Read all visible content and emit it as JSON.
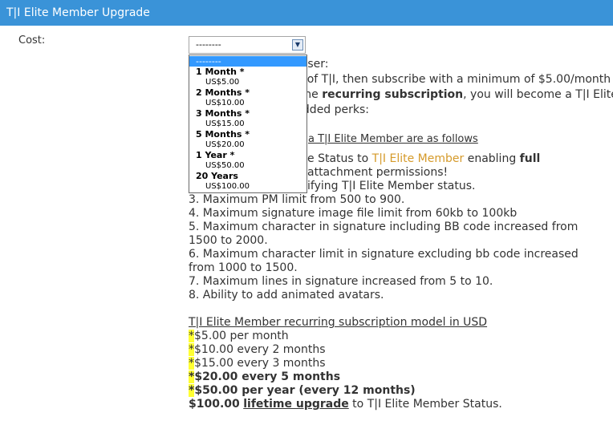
{
  "header": {
    "title": "T|I Elite Member Upgrade"
  },
  "form": {
    "cost_label": "Cost:"
  },
  "select": {
    "value": "--------",
    "options": [
      {
        "group": "1 Month *",
        "price": "US$5.00"
      },
      {
        "group": "2 Months *",
        "price": "US$10.00"
      },
      {
        "group": "3 Months *",
        "price": "US$15.00"
      },
      {
        "group": "5 Months *",
        "price": "US$20.00"
      },
      {
        "group": "1 Year *",
        "price": "US$50.00"
      },
      {
        "group": "20 Years",
        "price": "US$100.00"
      }
    ]
  },
  "intro": {
    "line1": "m User:",
    "line2": "ber of T|I, then subscribe with a minimum of $5.00/month",
    "line3_pre": "th the ",
    "line3_bold": "recurring subscription",
    "line3_post": ", you will become a T|I Elite",
    "line4": "g added perks:"
  },
  "perks": {
    "heading_partial": "a T|I Elite Member are as follows",
    "item1_pre": "e Status to ",
    "item1_gold": "T|I Elite Member",
    "item1_mid": " enabling ",
    "item1_bold": "full",
    "item1_cont": "attachment permissions!",
    "item2_partial": "ifying T|I Elite Member status.",
    "item3": "3. Maximum PM limit from 500 to 900.",
    "item4": "4. Maximum signature image file limit from 60kb to 100kb",
    "item5a": "5. Maximum character in signature including BB code increased from",
    "item5b": "1500 to 2000.",
    "item6a": "6. Maximum character limit in signature excluding bb code increased",
    "item6b": "from 1000 to 1500.",
    "item7": "7. Maximum lines in signature increased from 5 to 10.",
    "item8": "8. Ability to add animated avatars."
  },
  "subscription": {
    "heading": "T|I Elite Member recurring subscription model in USD",
    "star": "*",
    "rows": [
      "$5.00 per month",
      "$10.00 every 2 months",
      "$15.00 every 3 months",
      "$20.00 every 5 months",
      "$50.00 per year (every 12 months)"
    ],
    "lifetime_price": "$100.00",
    "lifetime_link": "lifetime upgrade",
    "lifetime_post": " to T|I Elite Member Status."
  }
}
